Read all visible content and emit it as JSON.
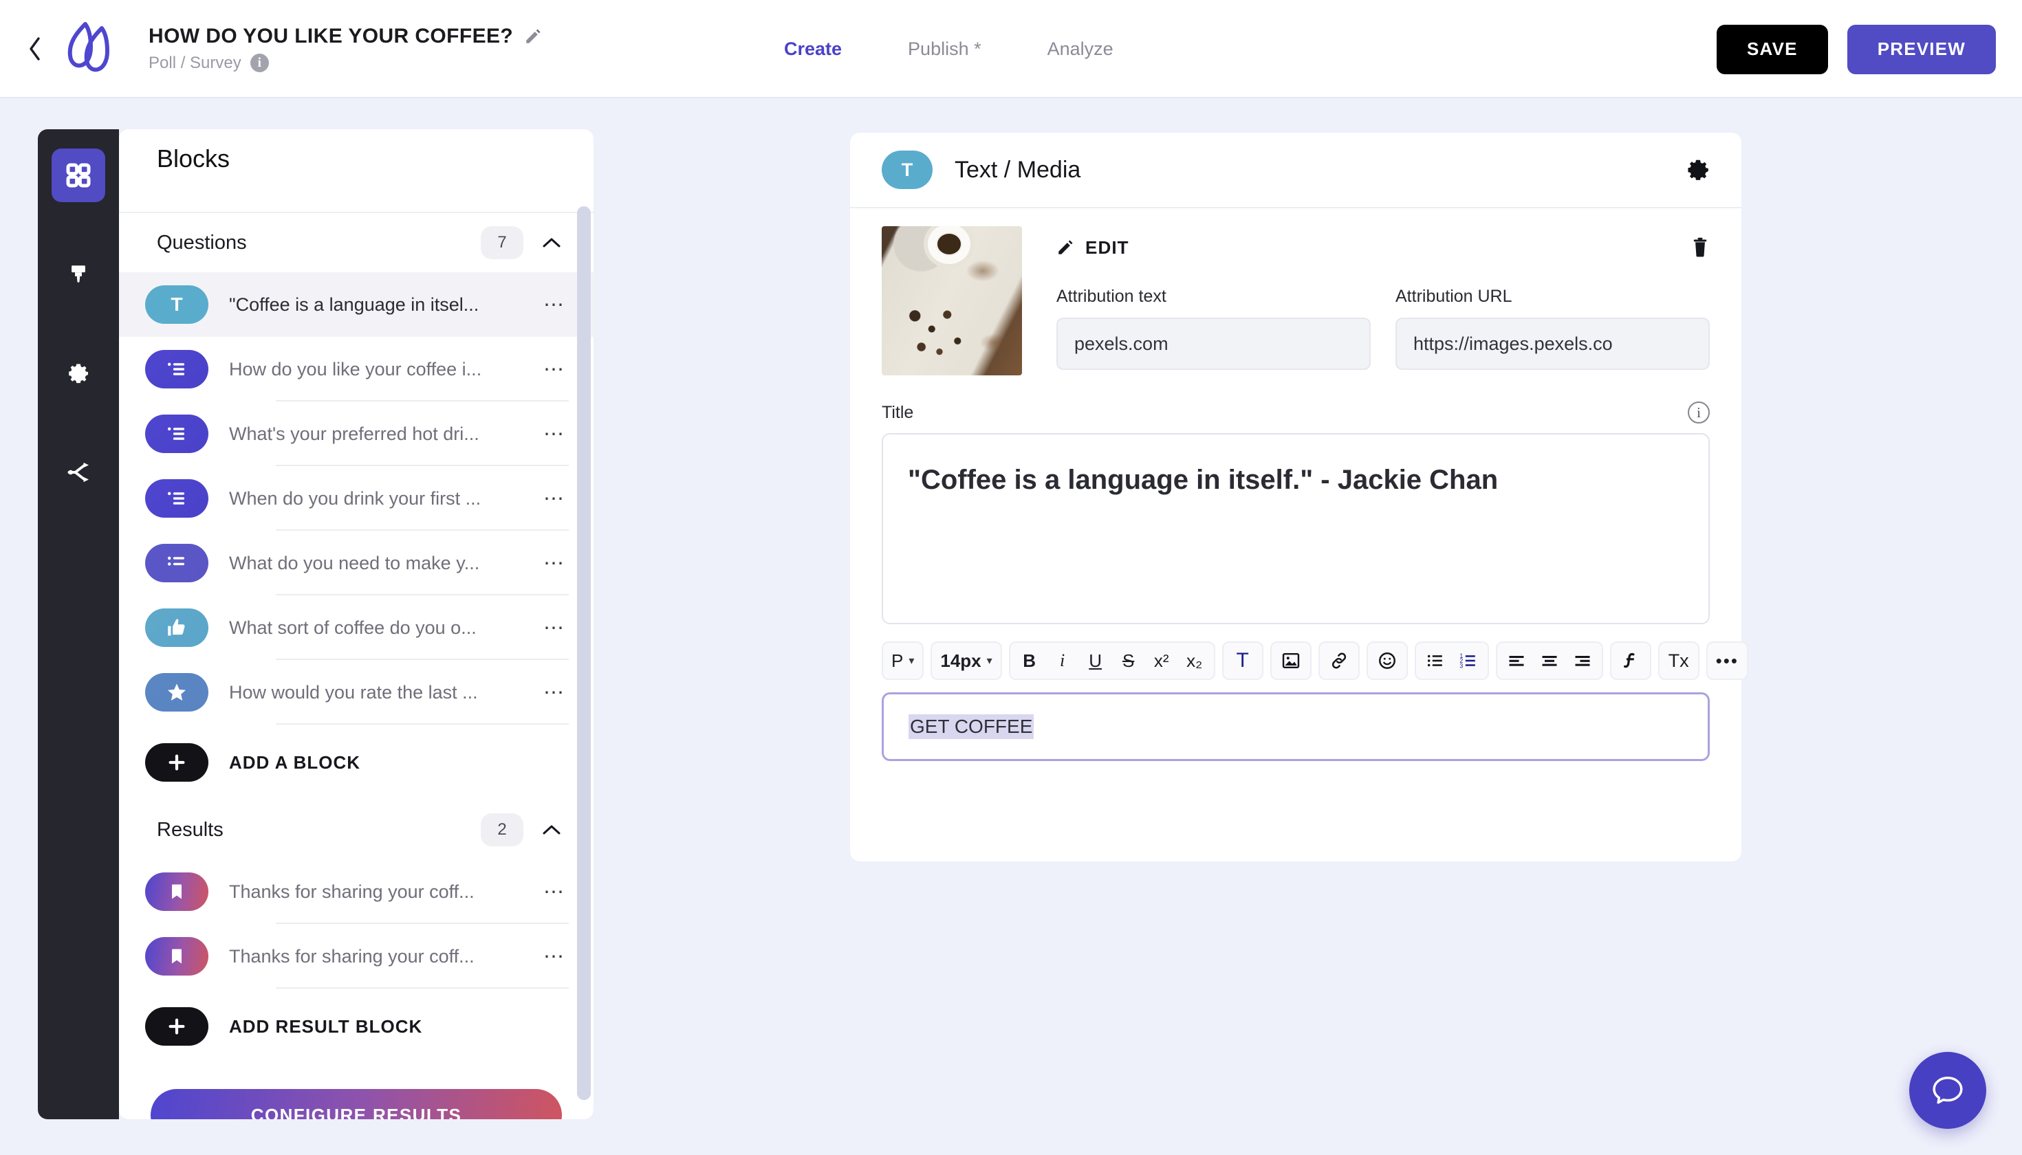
{
  "header": {
    "back_icon": "chevron-left-icon",
    "logo_icon": "brand-logo-icon",
    "survey_title": "HOW DO YOU LIKE YOUR COFFEE?",
    "edit_title_icon": "pencil-icon",
    "subtitle": "Poll / Survey",
    "subtitle_info_icon": "info-icon",
    "info_glyph": "i",
    "tabs": [
      {
        "label": "Create",
        "active": true
      },
      {
        "label": "Publish *",
        "active": false
      },
      {
        "label": "Analyze",
        "active": false
      }
    ],
    "save_label": "SAVE",
    "preview_label": "PREVIEW",
    "accent_color": "#514bc4"
  },
  "rail": {
    "items": [
      {
        "name": "blocks-icon",
        "active": true
      },
      {
        "name": "brush-icon",
        "active": false
      },
      {
        "name": "gear-icon",
        "active": false
      },
      {
        "name": "share-icon",
        "active": false
      }
    ]
  },
  "blocks_panel": {
    "title": "Blocks",
    "questions_section": {
      "label": "Questions",
      "count": "7",
      "collapse_icon": "chevron-up-icon",
      "items": [
        {
          "icon": "text-block-icon",
          "icon_glyph": "T",
          "style": "t",
          "label": "\"Coffee is a language in itsel...",
          "selected": true,
          "menu_icon": "more-options-icon"
        },
        {
          "icon": "multiple-choice-icon",
          "style": "ind",
          "label": "How do you like your coffee i...",
          "selected": false,
          "menu_icon": "more-options-icon"
        },
        {
          "icon": "multiple-choice-icon",
          "style": "ind",
          "label": "What's your preferred hot dri...",
          "selected": false,
          "menu_icon": "more-options-icon"
        },
        {
          "icon": "multiple-choice-icon",
          "style": "ind",
          "label": "When do you drink your first ...",
          "selected": false,
          "menu_icon": "more-options-icon"
        },
        {
          "icon": "multiple-choice-icon",
          "style": "ind2",
          "label": "What do you need to make y...",
          "selected": false,
          "menu_icon": "more-options-icon"
        },
        {
          "icon": "thumbs-up-icon",
          "style": "thumb",
          "label": "What sort of coffee do you o...",
          "selected": false,
          "menu_icon": "more-options-icon"
        },
        {
          "icon": "star-rating-icon",
          "style": "star",
          "label": "How would you rate the last ...",
          "selected": false,
          "menu_icon": "more-options-icon"
        }
      ],
      "add_label": "ADD A BLOCK",
      "add_icon": "plus-icon"
    },
    "results_section": {
      "label": "Results",
      "count": "2",
      "collapse_icon": "chevron-up-icon",
      "items": [
        {
          "icon": "bookmark-icon",
          "style": "book",
          "label": "Thanks for sharing your coff...",
          "menu_icon": "more-options-icon"
        },
        {
          "icon": "bookmark-icon",
          "style": "book",
          "label": "Thanks for sharing your coff...",
          "menu_icon": "more-options-icon"
        }
      ],
      "add_label": "ADD RESULT BLOCK",
      "add_icon": "plus-icon"
    },
    "configure_label": "CONFIGURE RESULTS"
  },
  "editor": {
    "block_type_glyph": "T",
    "block_type_icon": "text-block-icon",
    "block_type_title": "Text / Media",
    "settings_icon": "gear-icon",
    "media": {
      "image_icon": "coffee-notebook-image",
      "edit_label": "EDIT",
      "edit_icon": "pencil-icon",
      "delete_icon": "trash-icon",
      "attribution_text_label": "Attribution text",
      "attribution_text_value": "pexels.com",
      "attribution_text_placeholder": "Attribution text",
      "attribution_url_label": "Attribution URL",
      "attribution_url_value": "https://images.pexels.co",
      "attribution_url_placeholder": "Attribution URL"
    },
    "title_label": "Title",
    "title_info_icon": "info-icon",
    "title_info_glyph": "i",
    "title_value": "\"Coffee is a language in itself.\" - Jackie Chan",
    "toolbar": [
      {
        "name": "paragraph-style-select",
        "label": "P",
        "caret": "▾",
        "group": 0
      },
      {
        "name": "font-size-select",
        "label": "14px",
        "caret": "▾",
        "group": 1
      },
      {
        "name": "bold-button",
        "label": "B",
        "group": 2
      },
      {
        "name": "italic-button",
        "label": "i",
        "group": 2
      },
      {
        "name": "underline-button",
        "label": "U",
        "group": 2
      },
      {
        "name": "strikethrough-button",
        "label": "S",
        "group": 2
      },
      {
        "name": "superscript-button",
        "label": "x²",
        "group": 2
      },
      {
        "name": "subscript-button",
        "label": "x₂",
        "group": 2
      },
      {
        "name": "text-color-button",
        "label": "T",
        "group": 3
      },
      {
        "name": "insert-image-button",
        "label": "image-icon",
        "group": 4
      },
      {
        "name": "insert-link-button",
        "label": "link-icon",
        "group": 5
      },
      {
        "name": "emoji-button",
        "label": "emoji-icon",
        "group": 6
      },
      {
        "name": "bulleted-list-button",
        "label": "bullet-list-icon",
        "group": 7
      },
      {
        "name": "numbered-list-button",
        "label": "numbered-list-icon",
        "group": 7
      },
      {
        "name": "align-left-button",
        "label": "align-left-icon",
        "group": 8
      },
      {
        "name": "align-center-button",
        "label": "align-center-icon",
        "group": 8
      },
      {
        "name": "align-right-button",
        "label": "align-right-icon",
        "group": 8
      },
      {
        "name": "formula-button",
        "label": "formula-icon",
        "group": 9
      },
      {
        "name": "clear-formatting-button",
        "label": "Tx",
        "group": 10
      },
      {
        "name": "more-options-button",
        "label": "•••",
        "group": 11
      }
    ],
    "body_text": "GET COFFEE"
  },
  "chat": {
    "icon": "chat-bubble-icon"
  }
}
